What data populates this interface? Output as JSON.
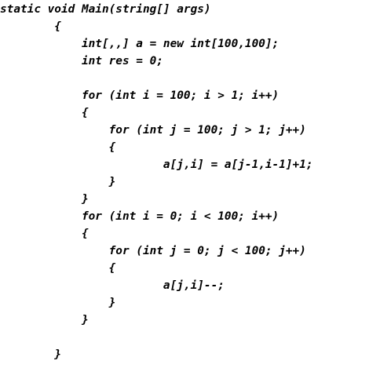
{
  "code": {
    "lines": [
      "static void Main(string[] args)",
      "        {",
      "            int[,,] a = new int[100,100];",
      "            int res = 0;",
      "",
      "            for (int i = 100; i > 1; i++)",
      "            {",
      "                for (int j = 100; j > 1; j++)",
      "                {",
      "                        a[j,i] = a[j-1,i-1]+1;",
      "                }",
      "            }",
      "            for (int i = 0; i < 100; i++)",
      "            {",
      "                for (int j = 0; j < 100; j++)",
      "                {",
      "                        a[j,i]--;",
      "                }",
      "            }",
      "",
      "        }"
    ]
  }
}
